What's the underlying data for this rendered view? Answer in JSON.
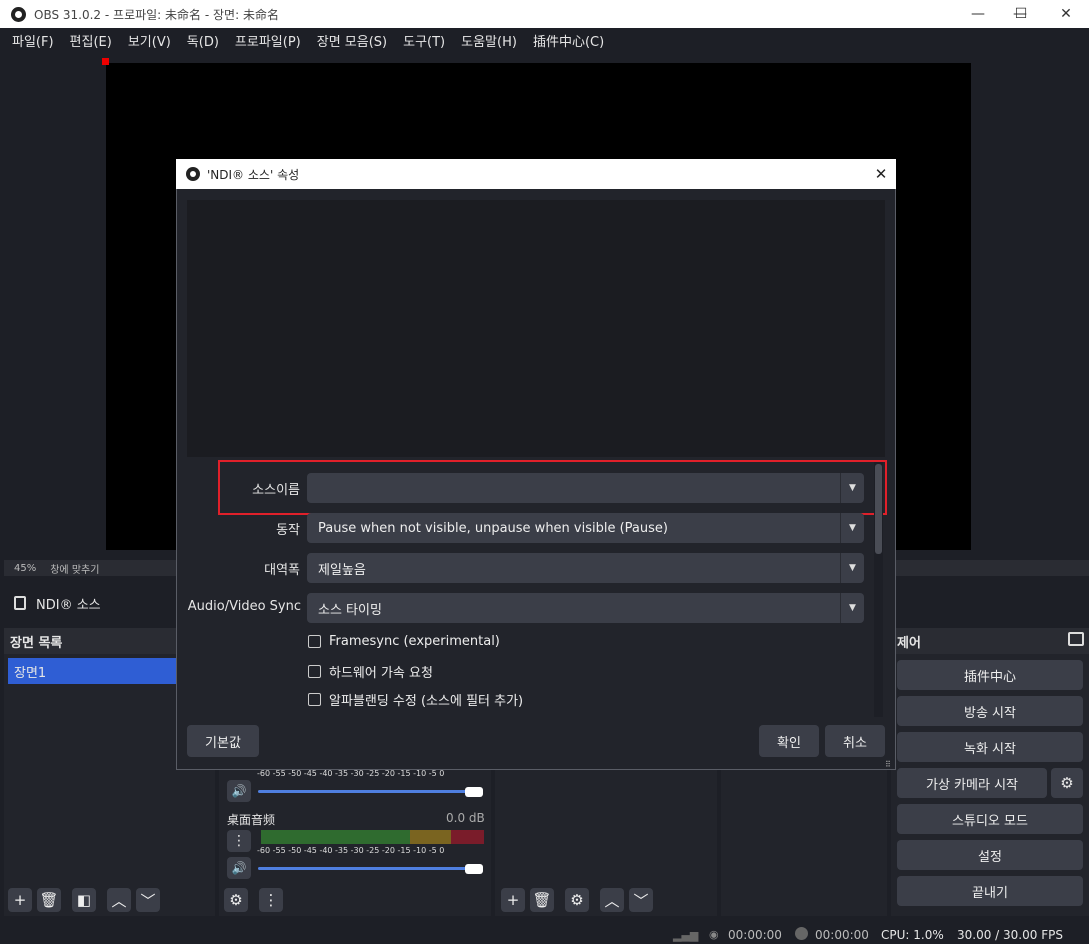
{
  "window": {
    "title": "OBS 31.0.2 - 프로파일: 未命名 - 장면: 未命名",
    "minimize": "—",
    "maximize": "☐",
    "close": "✕"
  },
  "menu": [
    "파일(F)",
    "편집(E)",
    "보기(V)",
    "독(D)",
    "프로파일(P)",
    "장면 모음(S)",
    "도구(T)",
    "도움말(H)",
    "插件中心(C)"
  ],
  "preview": {
    "zoom": "45%",
    "fit_label": "창에 맞추기"
  },
  "source_bar": {
    "source_name": "NDI® 소스"
  },
  "scenes": {
    "header": "장면 목록",
    "items": [
      "장면1"
    ]
  },
  "mixer": {
    "ticks": "-60 -55 -50 -45 -40 -35 -30 -25 -20 -15 -10 -5 0",
    "channels": [
      {
        "name": "",
        "db": ""
      },
      {
        "name": "桌面音频",
        "db": "0.0 dB"
      }
    ]
  },
  "controls": {
    "header": "제어",
    "buttons": [
      "插件中心",
      "방송 시작",
      "녹화 시작",
      "가상 카메라 시작",
      "스튜디오 모드",
      "설정",
      "끝내기"
    ]
  },
  "status": {
    "live_time": "00:00:00",
    "rec_time": "00:00:00",
    "cpu": "CPU: 1.0%",
    "fps": "30.00 / 30.00 FPS"
  },
  "dialog": {
    "title": "'NDI® 소스' 속성",
    "close": "✕",
    "fields": {
      "source_name_label": "소스이름",
      "source_name_value": "",
      "behavior_label": "동작",
      "behavior_value": "Pause when not visible, unpause when visible (Pause)",
      "bandwidth_label": "대역폭",
      "bandwidth_value": "제일높음",
      "av_sync_label": "Audio/Video Sync",
      "av_sync_value": "소스 타이밍"
    },
    "checkboxes": [
      {
        "label": "Framesync (experimental)",
        "checked": false
      },
      {
        "label": "하드웨어 가속 요청",
        "checked": false
      },
      {
        "label": "알파블랜딩 수정 (소스에 필터 추가)",
        "checked": false
      }
    ],
    "buttons": {
      "defaults": "기본값",
      "ok": "확인",
      "cancel": "취소"
    }
  },
  "colors": {
    "background": "#1d1f26",
    "dock": "#22242b",
    "button": "#3b3e48",
    "accent": "#2f5ed4",
    "highlight": "#e0202a"
  }
}
